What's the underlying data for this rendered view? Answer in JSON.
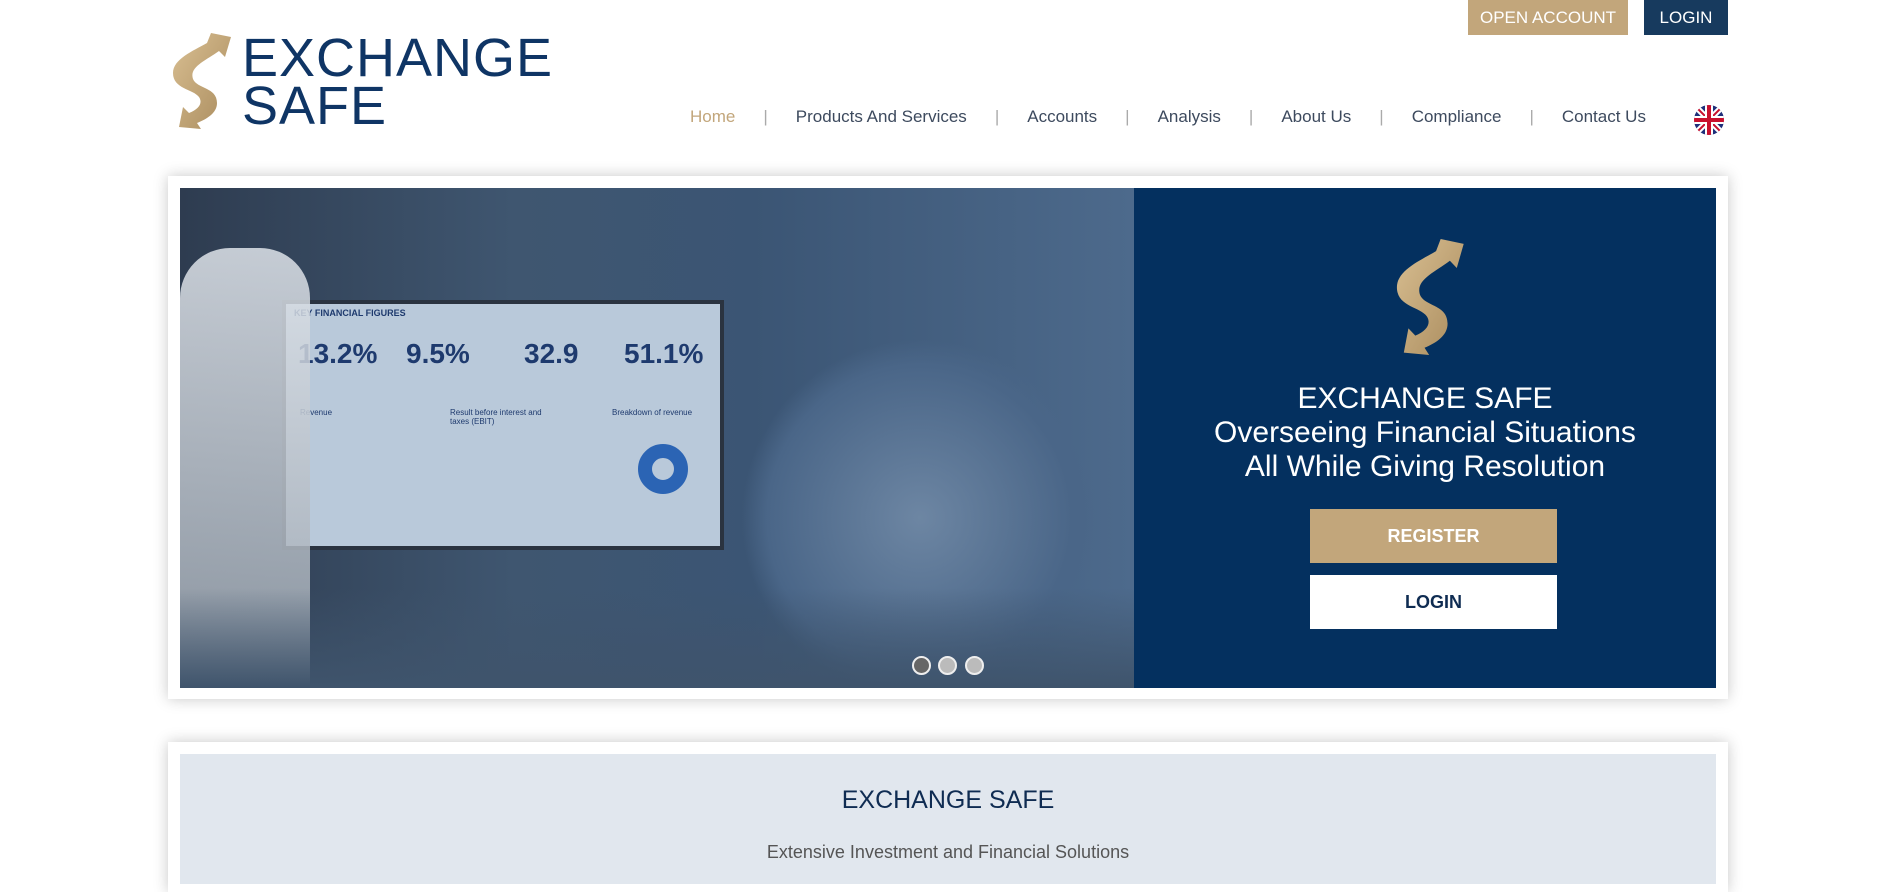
{
  "top_bar": {
    "open_account": "OPEN ACCOUNT",
    "login": "LOGIN"
  },
  "logo": {
    "line1": "EXCHANGE",
    "line2": "SAFE"
  },
  "nav": {
    "items": [
      {
        "label": "Home",
        "active": true
      },
      {
        "label": "Products And Services"
      },
      {
        "label": "Accounts"
      },
      {
        "label": "Analysis"
      },
      {
        "label": "About Us"
      },
      {
        "label": "Compliance"
      },
      {
        "label": "Contact Us"
      }
    ],
    "language_icon": "uk-flag-icon"
  },
  "hero": {
    "screen": {
      "heading": "KEY FINANCIAL FIGURES",
      "figures": [
        "13.2%",
        "9.5%",
        "32.9",
        "51.1%"
      ],
      "charts": [
        "Revenue",
        "Result before interest and taxes (EBIT)",
        "Breakdown of revenue"
      ]
    },
    "title": "EXCHANGE SAFE",
    "subtitle_line1": "Overseeing Financial Situations",
    "subtitle_line2": "All While Giving Resolution",
    "register": "REGISTER",
    "login": "LOGIN",
    "slides": 3,
    "active_slide": 1
  },
  "intro": {
    "title": "EXCHANGE SAFE",
    "subtitle": "Extensive Investment and Financial Solutions"
  },
  "colors": {
    "gold": "#c2a67b",
    "navy": "#04305f",
    "light_panel": "#e1e7ee"
  }
}
